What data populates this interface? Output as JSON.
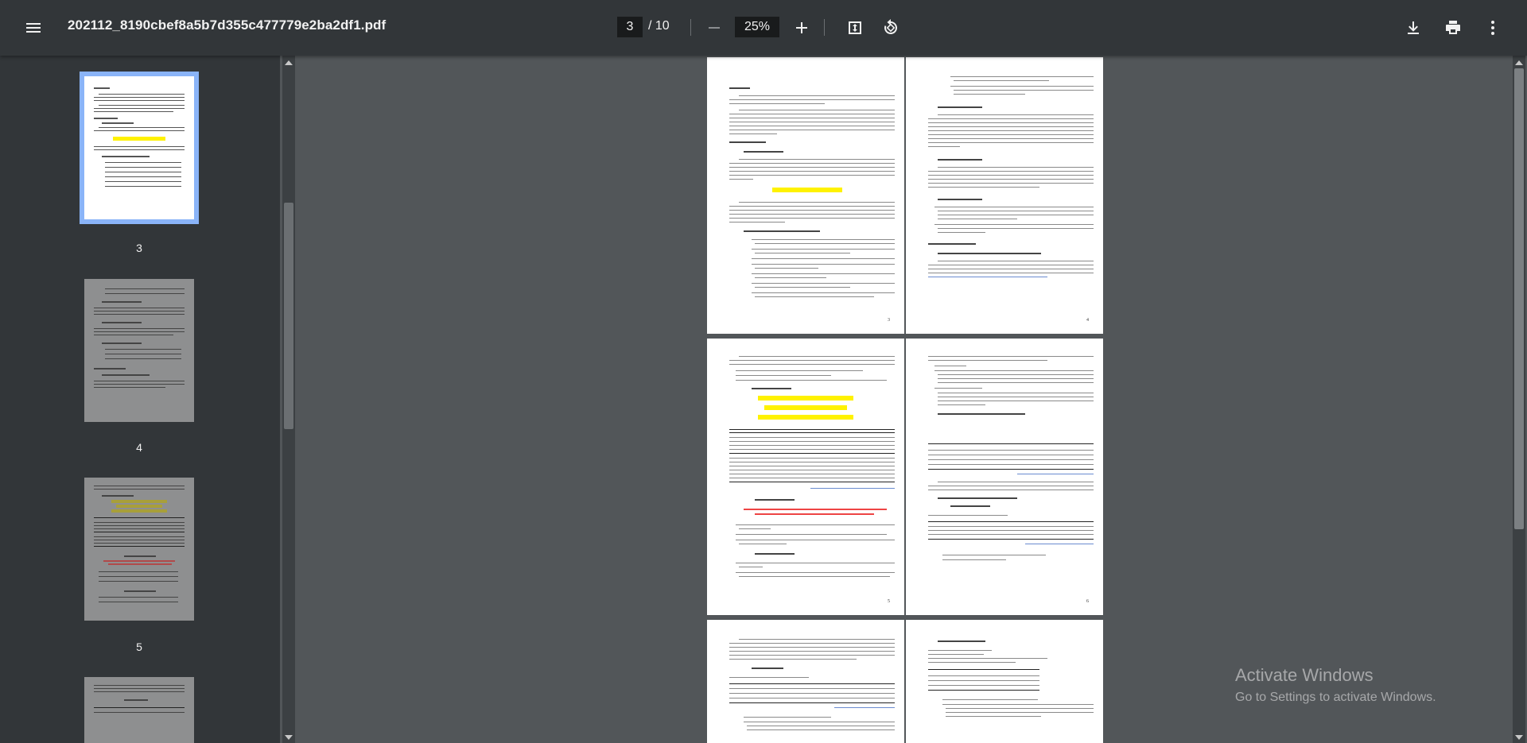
{
  "toolbar": {
    "menu_icon": "hamburger-menu-icon",
    "file_name": "202112_8190cbef8a5b7d355c477779e2ba2df1.pdf",
    "current_page": "3",
    "total_pages": "/ 10",
    "zoom_out_icon": "minus-icon",
    "zoom_level": "25%",
    "zoom_in_icon": "plus-icon",
    "fit_icon": "fit-to-page-icon",
    "rotate_icon": "rotate-icon",
    "download_icon": "download-icon",
    "print_icon": "print-icon",
    "more_icon": "more-vert-icon"
  },
  "sidebar": {
    "thumbnails": [
      {
        "page": "3",
        "active": true
      },
      {
        "page": "4",
        "active": false
      },
      {
        "page": "5",
        "active": false
      }
    ]
  },
  "viewer": {
    "pages": [
      "3",
      "4",
      "5",
      "6"
    ]
  },
  "watermark": {
    "line1": "Activate Windows",
    "line2": "Go to Settings to activate Windows."
  }
}
